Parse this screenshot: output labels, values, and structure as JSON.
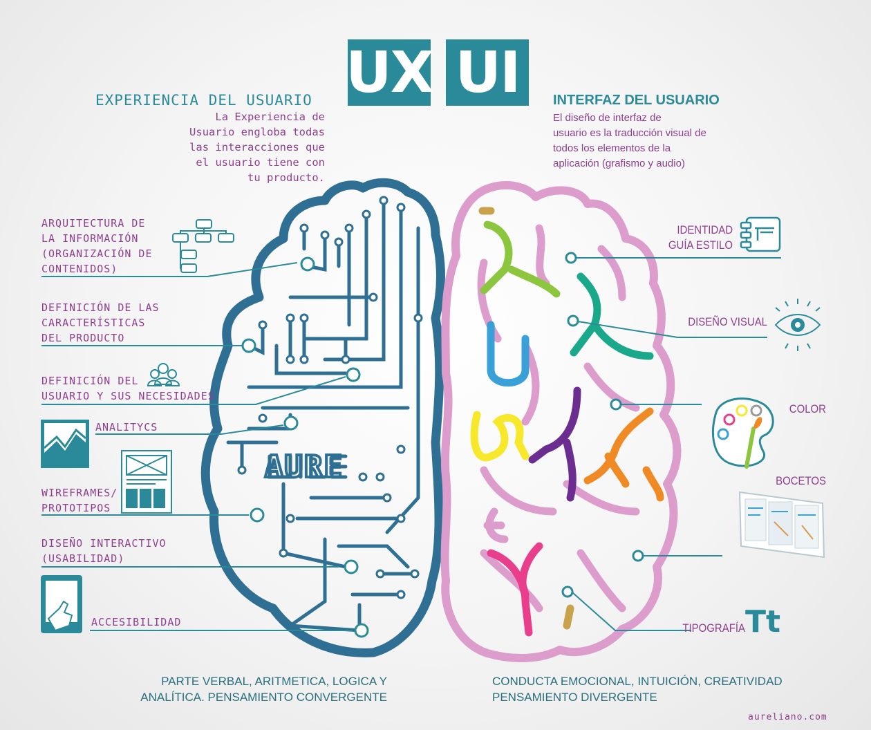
{
  "header": {
    "ux_box": "UX",
    "ui_box": "UI",
    "ux_title": "EXPERIENCIA DEL USUARIO",
    "ux_description": "La Experiencia de\nUsuario engloba todas\nlas interacciones que\nel usuario tiene con\ntu producto.",
    "ui_title": "INTERFAZ DEL USUARIO",
    "ui_description": "El diseño de interfaz de\nusuario es la traducción visual de\ntodos los elementos de la\naplicación (grafismo y audio)"
  },
  "left_labels": [
    "ARQUITECTURA DE\nLA INFORMACIÓN\n(ORGANIZACIÓN DE\nCONTENIDOS)",
    "DEFINICIÓN DE LAS\nCARACTERÍSTICAS\nDEL PRODUCTO",
    "DEFINICIÓN DEL\nUSUARIO Y SUS NECESIDADES",
    "ANALITYCS",
    "WIREFRAMES/\nPROTOTIPOS",
    "DISEÑO INTERACTIVO\n(USABILIDAD)",
    "ACCESIBILIDAD"
  ],
  "right_labels": [
    "IDENTIDAD\nGUÍA ESTILO",
    "DISEÑO VISUAL",
    "COLOR",
    "BOCETOS",
    "TIPOGRAFÍA"
  ],
  "typography_icon_text": "Tt",
  "brain_text": "AURE",
  "footer": {
    "left": "PARTE VERBAL, ARITMETICA, LOGICA Y\nANALÍTICA. PENSAMIENTO CONVERGENTE",
    "right": "CONDUCTA EMOCIONAL, INTUICIÓN, CREATIVIDAD\nPENSAMIENTO DIVERGENTE"
  },
  "credit": "aureliano.com",
  "colors": {
    "teal": "#2a8a99",
    "brain_left": "#2e6f93",
    "brain_right": "#dc9ccc",
    "label_purple": "#8f3e8f"
  }
}
